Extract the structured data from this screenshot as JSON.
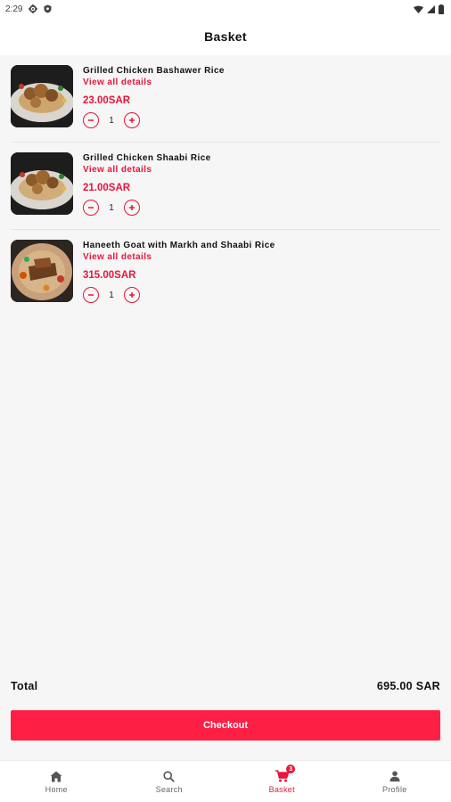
{
  "status_bar": {
    "time": "2:29",
    "icons": [
      "gear-icon",
      "shield-icon",
      "wifi-icon",
      "signal-icon",
      "battery-icon"
    ]
  },
  "header": {
    "title": "Basket"
  },
  "basket": {
    "items": [
      {
        "name": "Grilled Chicken Bashawer Rice",
        "details_link": "View all details",
        "price": "23.00SAR",
        "quantity": "1",
        "image": "chicken-rice-photo"
      },
      {
        "name": "Grilled Chicken Shaabi Rice",
        "details_link": "View all details",
        "price": "21.00SAR",
        "quantity": "1",
        "image": "chicken-rice-photo"
      },
      {
        "name": "Haneeth Goat with Markh and Shaabi Rice",
        "details_link": "View all details",
        "price": "315.00SAR",
        "quantity": "1",
        "image": "goat-rice-photo"
      }
    ]
  },
  "summary": {
    "total_label": "Total",
    "total_value": "695.00 SAR"
  },
  "checkout_label": "Checkout",
  "bottom_nav": {
    "items": [
      {
        "label": "Home",
        "icon": "home-icon",
        "active": false
      },
      {
        "label": "Search",
        "icon": "search-icon",
        "active": false
      },
      {
        "label": "Basket",
        "icon": "cart-icon",
        "active": true,
        "badge": "3"
      },
      {
        "label": "Profile",
        "icon": "person-icon",
        "active": false
      }
    ]
  },
  "colors": {
    "accent": "#e8153b",
    "checkout_button": "#fd1f44",
    "background": "#f6f6f6"
  }
}
